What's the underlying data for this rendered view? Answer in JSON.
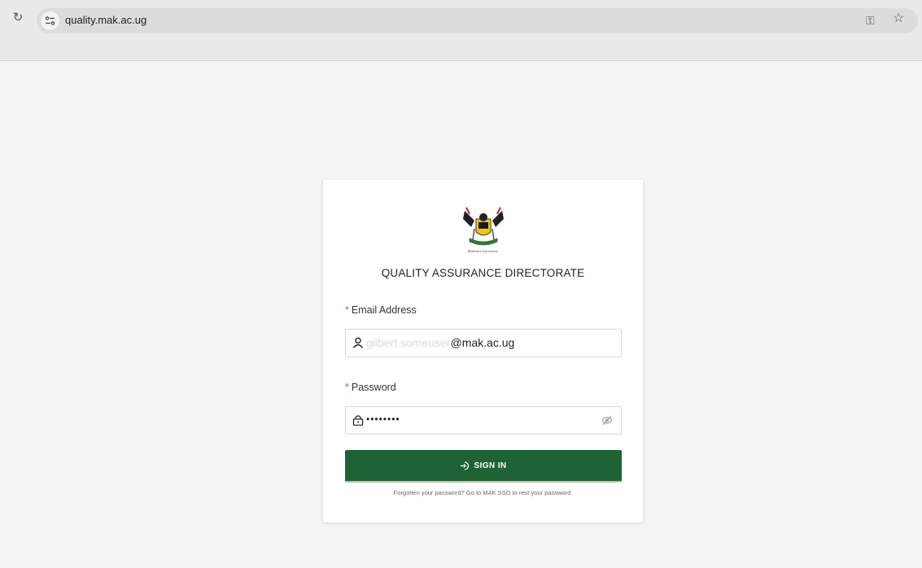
{
  "browser": {
    "url": "quality.mak.ac.ug",
    "icons": [
      "reload-icon",
      "site-info-icon",
      "key-icon",
      "bookmark-star-icon"
    ]
  },
  "login": {
    "logo_caption": "Makerere University",
    "title": "QUALITY ASSURANCE DIRECTORATE",
    "email_label": "Email Address",
    "email_value_hidden": "gilbert.someuser",
    "email_value_domain": "@mak.ac.ug",
    "password_label": "Password",
    "password_value": "••••••••",
    "required_marker": "*",
    "signin_label": "SIGN IN",
    "footnote": "Forgotten your password? Go to MAK SSO to rest your password."
  },
  "colors": {
    "primary": "#1e6335",
    "required": "#e05050",
    "background": "#f4f4f4"
  }
}
